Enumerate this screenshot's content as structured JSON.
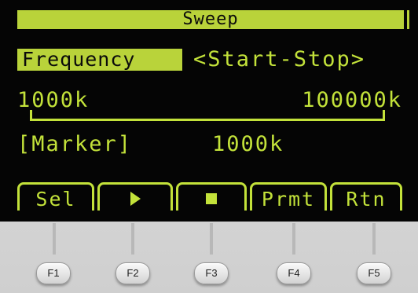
{
  "screen": {
    "title": "Sweep",
    "parameter_label": "Frequency",
    "mode": "<Start-Stop>",
    "start_value": "1000k",
    "stop_value": "100000k",
    "marker_label": "[Marker]",
    "marker_value": "1000k"
  },
  "softkeys": [
    {
      "label": "Sel"
    },
    {
      "label": "",
      "icon": "play-icon"
    },
    {
      "label": "",
      "icon": "stop-icon"
    },
    {
      "label": "Prmt"
    },
    {
      "label": "Rtn"
    }
  ],
  "function_keys": [
    "F1",
    "F2",
    "F3",
    "F4",
    "F5"
  ],
  "colors": {
    "lcd_foreground": "#c3e23a",
    "lcd_background": "#050505",
    "highlight": "#b9d33a",
    "bezel": "#d8d8d8"
  }
}
